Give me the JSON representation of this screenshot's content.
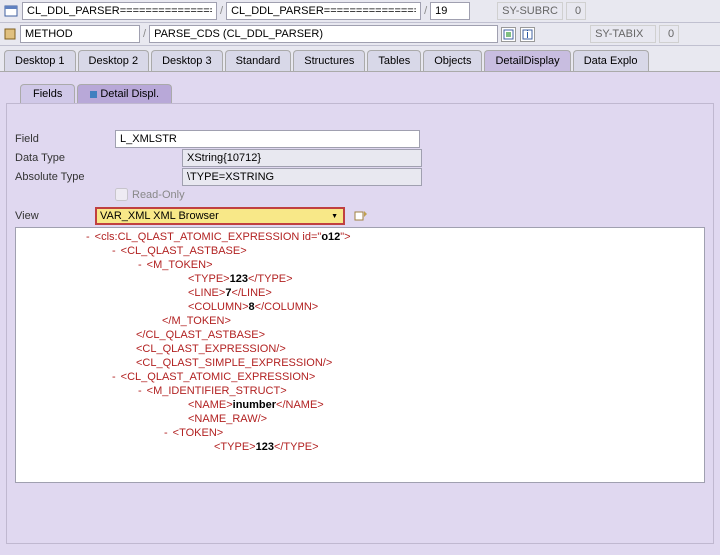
{
  "top": {
    "input1": "CL_DDL_PARSER===============",
    "input2": "CL_DDL_PARSER===============",
    "input3": "19",
    "sy_subrc_label": "SY-SUBRC",
    "sy_subrc_val": "0"
  },
  "row2": {
    "method": "METHOD",
    "parse": "PARSE_CDS (CL_DDL_PARSER)",
    "sy_tabix_label": "SY-TABIX",
    "sy_tabix_val": "0"
  },
  "tabs": [
    "Desktop 1",
    "Desktop 2",
    "Desktop 3",
    "Standard",
    "Structures",
    "Tables",
    "Objects",
    "DetailDisplay",
    "Data Explo"
  ],
  "subtabs": {
    "fields": "Fields",
    "detail": "Detail Displ."
  },
  "form": {
    "field_lbl": "Field",
    "field_val": "L_XMLSTR",
    "datatype_lbl": "Data Type",
    "datatype_val": "XString{10712}",
    "abstype_lbl": "Absolute Type",
    "abstype_val": "\\TYPE=XSTRING",
    "readonly_lbl": "Read-Only"
  },
  "view": {
    "lbl": "View",
    "selected": "VAR_XML XML Browser"
  },
  "xml": [
    {
      "indent": 78,
      "dash": true,
      "parts": [
        {
          "t": "tag",
          "v": "<cls:CL_QLAST_ATOMIC_EXPRESSION "
        },
        {
          "t": "attr",
          "v": "id=\""
        },
        {
          "t": "attrv",
          "v": "o12"
        },
        {
          "t": "tag",
          "v": "\">"
        }
      ]
    },
    {
      "indent": 104,
      "dash": true,
      "parts": [
        {
          "t": "tag",
          "v": "<CL_QLAST_ASTBASE>"
        }
      ]
    },
    {
      "indent": 130,
      "dash": true,
      "parts": [
        {
          "t": "tag",
          "v": "<M_TOKEN>"
        }
      ]
    },
    {
      "indent": 168,
      "dash": false,
      "parts": [
        {
          "t": "tag",
          "v": "<TYPE>"
        },
        {
          "t": "txt",
          "v": "123"
        },
        {
          "t": "tag",
          "v": "</TYPE>"
        }
      ]
    },
    {
      "indent": 168,
      "dash": false,
      "parts": [
        {
          "t": "tag",
          "v": "<LINE>"
        },
        {
          "t": "txt",
          "v": "7"
        },
        {
          "t": "tag",
          "v": "</LINE>"
        }
      ]
    },
    {
      "indent": 168,
      "dash": false,
      "parts": [
        {
          "t": "tag",
          "v": "<COLUMN>"
        },
        {
          "t": "txt",
          "v": "8"
        },
        {
          "t": "tag",
          "v": "</COLUMN>"
        }
      ]
    },
    {
      "indent": 142,
      "dash": false,
      "parts": [
        {
          "t": "tag",
          "v": "</M_TOKEN>"
        }
      ]
    },
    {
      "indent": 116,
      "dash": false,
      "parts": [
        {
          "t": "tag",
          "v": "</CL_QLAST_ASTBASE>"
        }
      ]
    },
    {
      "indent": 116,
      "dash": false,
      "parts": [
        {
          "t": "tag",
          "v": "<CL_QLAST_EXPRESSION/>"
        }
      ]
    },
    {
      "indent": 116,
      "dash": false,
      "parts": [
        {
          "t": "tag",
          "v": "<CL_QLAST_SIMPLE_EXPRESSION/>"
        }
      ]
    },
    {
      "indent": 104,
      "dash": true,
      "parts": [
        {
          "t": "tag",
          "v": "<CL_QLAST_ATOMIC_EXPRESSION>"
        }
      ]
    },
    {
      "indent": 130,
      "dash": true,
      "parts": [
        {
          "t": "tag",
          "v": "<M_IDENTIFIER_STRUCT>"
        }
      ]
    },
    {
      "indent": 168,
      "dash": false,
      "parts": [
        {
          "t": "tag",
          "v": "<NAME>"
        },
        {
          "t": "txt",
          "v": "inumber"
        },
        {
          "t": "tag",
          "v": "</NAME>"
        }
      ]
    },
    {
      "indent": 168,
      "dash": false,
      "parts": [
        {
          "t": "tag",
          "v": "<NAME_RAW/>"
        }
      ]
    },
    {
      "indent": 156,
      "dash": true,
      "parts": [
        {
          "t": "tag",
          "v": "<TOKEN>"
        }
      ]
    },
    {
      "indent": 194,
      "dash": false,
      "parts": [
        {
          "t": "tag",
          "v": "<TYPE>"
        },
        {
          "t": "txt",
          "v": "123"
        },
        {
          "t": "tag",
          "v": "</TYPE>"
        }
      ]
    }
  ]
}
